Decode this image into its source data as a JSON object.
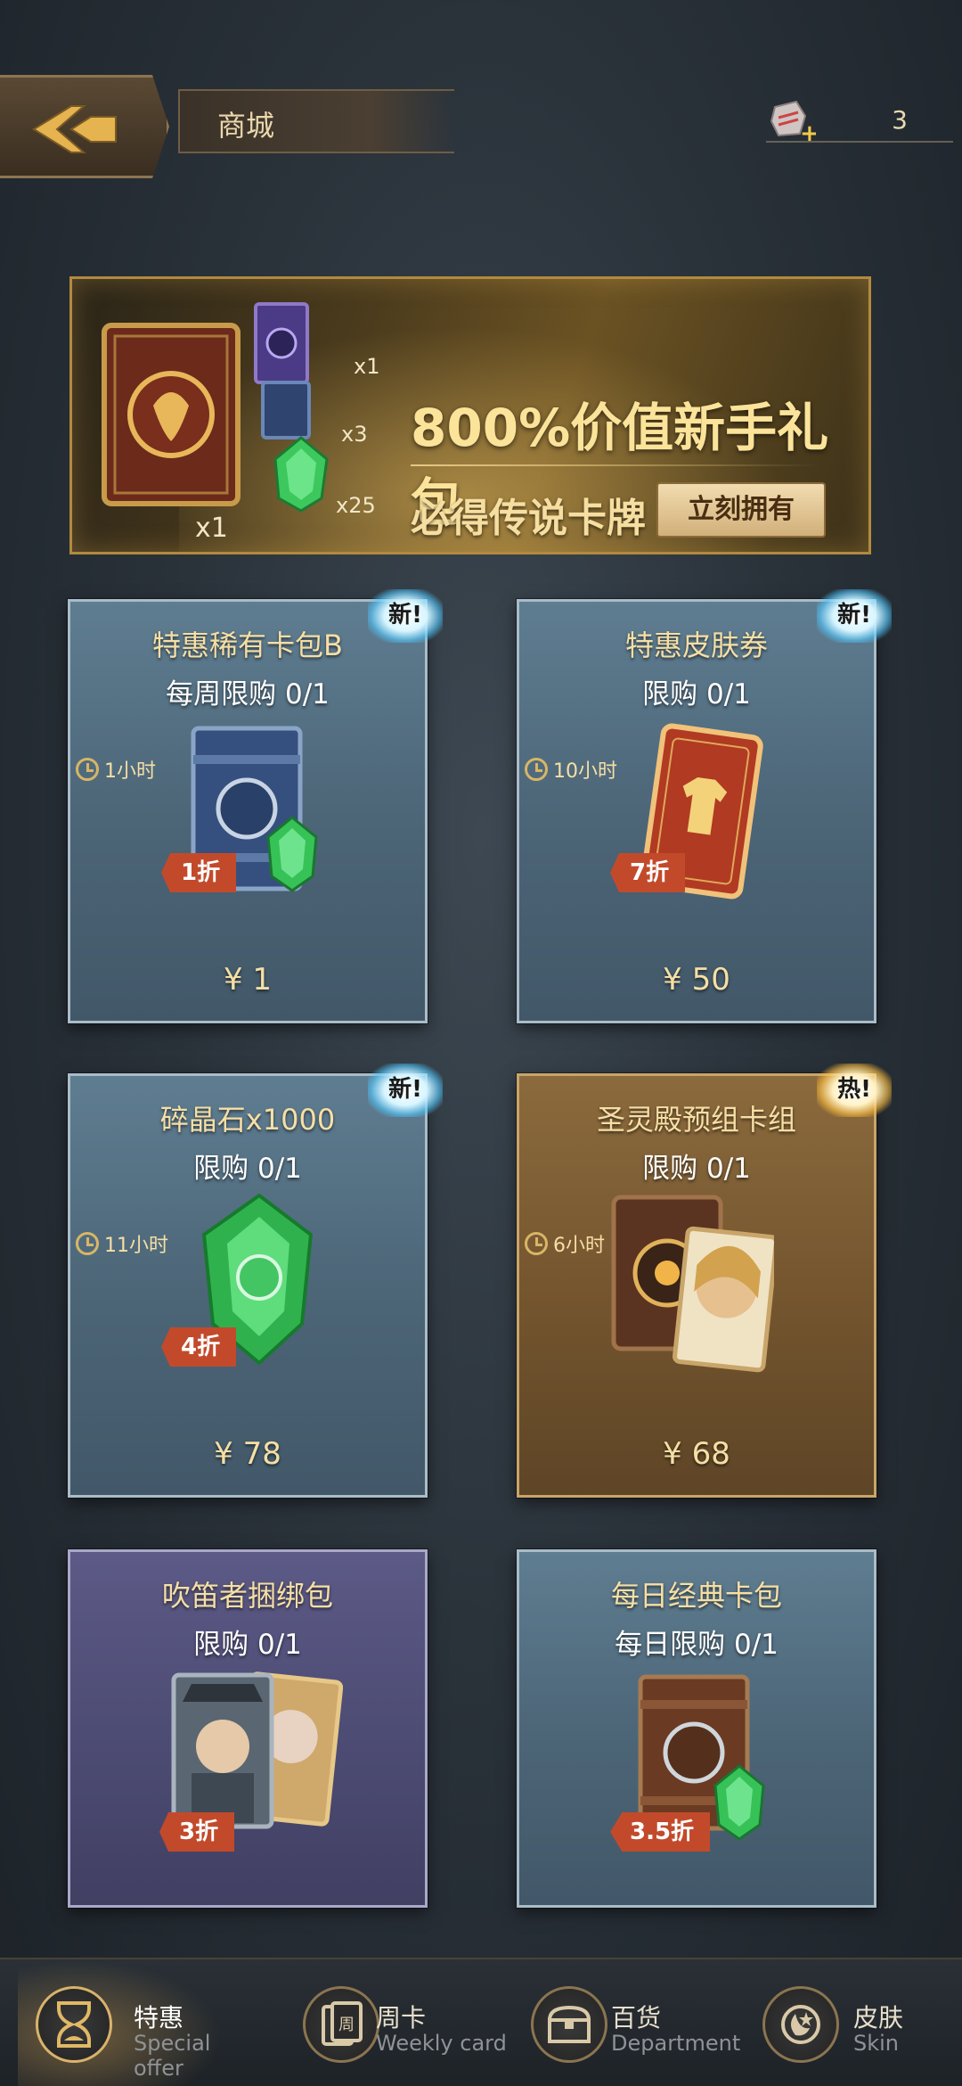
{
  "header": {
    "title": "商城",
    "currency_value": "3"
  },
  "banner": {
    "title": "800%价值新手礼包",
    "subtitle": "必得传说卡牌",
    "button_label": "立刻拥有",
    "mult_main": "x1",
    "mult_purple": "x1",
    "mult_blue": "x3",
    "mult_gem": "x25"
  },
  "cards": [
    {
      "title": "特惠稀有卡包B",
      "limit": "每周限购 0/1",
      "timer": "1小时",
      "discount": "1折",
      "price": "¥ 1",
      "badge": "新!"
    },
    {
      "title": "特惠皮肤券",
      "limit": "限购 0/1",
      "timer": "10小时",
      "discount": "7折",
      "price": "¥ 50",
      "badge": "新!"
    },
    {
      "title": "碎晶石x1000",
      "limit": "限购 0/1",
      "timer": "11小时",
      "discount": "4折",
      "price": "¥ 78",
      "badge": "新!"
    },
    {
      "title": "圣灵殿预组卡组",
      "limit": "限购 0/1",
      "timer": "6小时",
      "discount": "",
      "price": "¥ 68",
      "badge": "热!"
    },
    {
      "title": "吹笛者捆绑包",
      "limit": "限购 0/1",
      "timer": "",
      "discount": "3折",
      "price": "",
      "badge": ""
    },
    {
      "title": "每日经典卡包",
      "limit": "每日限购 0/1",
      "timer": "",
      "discount": "3.5折",
      "price": "",
      "badge": ""
    }
  ],
  "nav": [
    {
      "cn": "特惠",
      "en": "Special offer"
    },
    {
      "cn": "周卡",
      "en": "Weekly card"
    },
    {
      "cn": "百货",
      "en": "Department"
    },
    {
      "cn": "皮肤",
      "en": "Skin"
    }
  ],
  "colors": {
    "accent_gold": "#f6dfa5",
    "discount_red": "#c24a2b",
    "card_blue": "#4b6476",
    "card_gold": "#75562f",
    "card_purple": "#4c4b73"
  },
  "icons": [
    "back-arrow-icon",
    "shard-currency-icon",
    "clock-icon",
    "card-pack-icon",
    "gem-icon",
    "shirt-icon",
    "deck-icon",
    "hourglass-icon",
    "weekly-card-icon",
    "chest-icon",
    "skin-icon"
  ]
}
